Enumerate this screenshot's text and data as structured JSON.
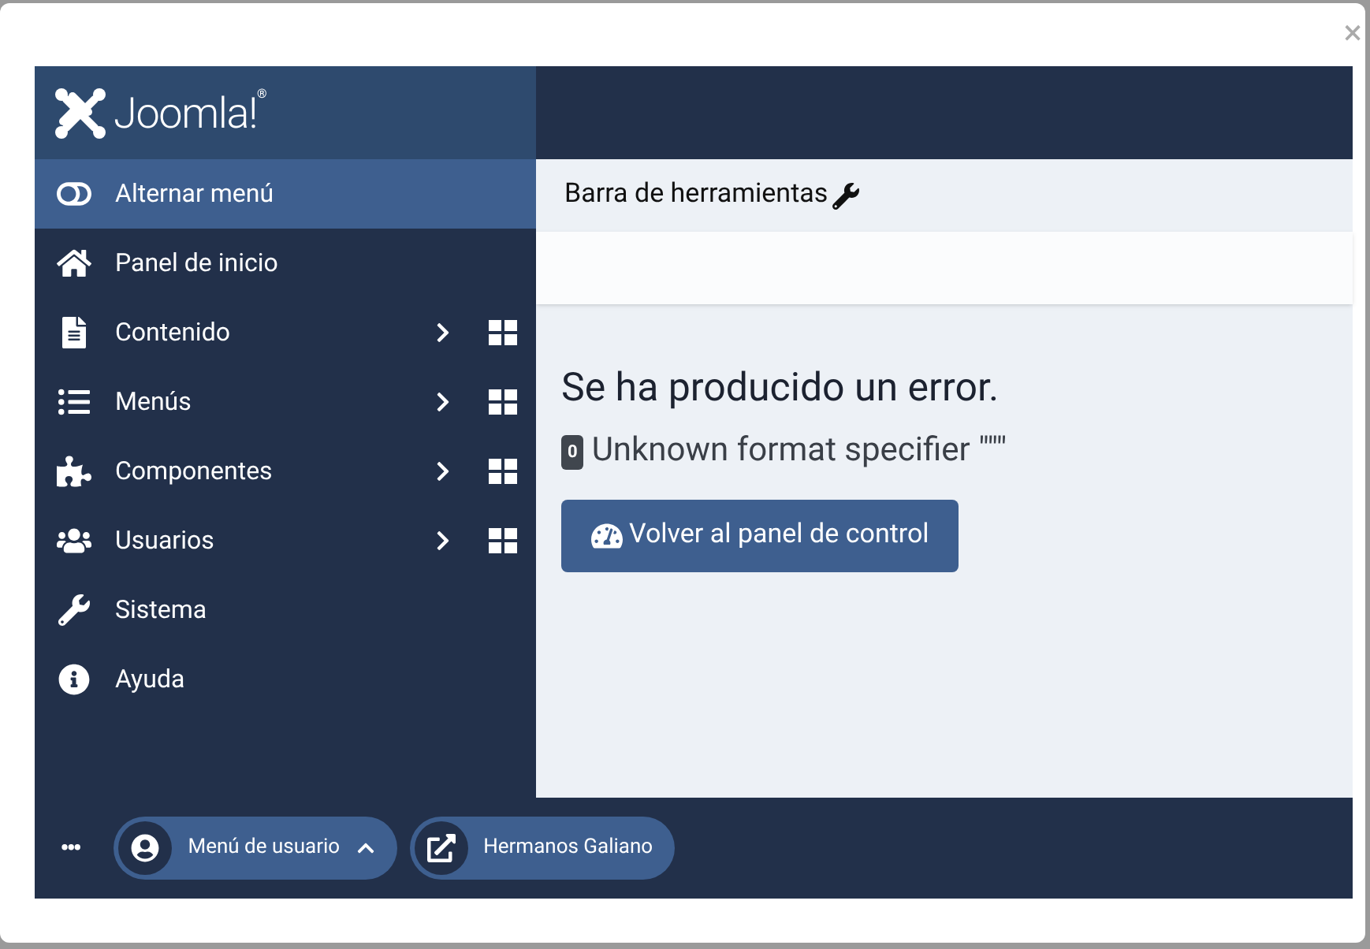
{
  "modal": {
    "close": "×"
  },
  "brand": {
    "name": "Joomla!",
    "mark": "®"
  },
  "sidebar": {
    "items": [
      {
        "label": "Alternar menú",
        "selected": true,
        "submenu": false
      },
      {
        "label": "Panel de inicio",
        "selected": false,
        "submenu": false
      },
      {
        "label": "Contenido",
        "selected": false,
        "submenu": true
      },
      {
        "label": "Menús",
        "selected": false,
        "submenu": true
      },
      {
        "label": "Componentes",
        "selected": false,
        "submenu": true
      },
      {
        "label": "Usuarios",
        "selected": false,
        "submenu": true
      },
      {
        "label": "Sistema",
        "selected": false,
        "submenu": false
      },
      {
        "label": "Ayuda",
        "selected": false,
        "submenu": false
      }
    ]
  },
  "toolbar": {
    "title": "Barra de herramientas"
  },
  "error": {
    "heading": "Se ha producido un error.",
    "code": "0",
    "message": "Unknown format specifier \"\"\"",
    "button": "Volver al panel de control"
  },
  "footer": {
    "more": "•••",
    "buttons": [
      {
        "label": "Menú de usuario",
        "kind": "menu"
      },
      {
        "label": "Hermanos Galiano",
        "kind": "link"
      }
    ]
  }
}
